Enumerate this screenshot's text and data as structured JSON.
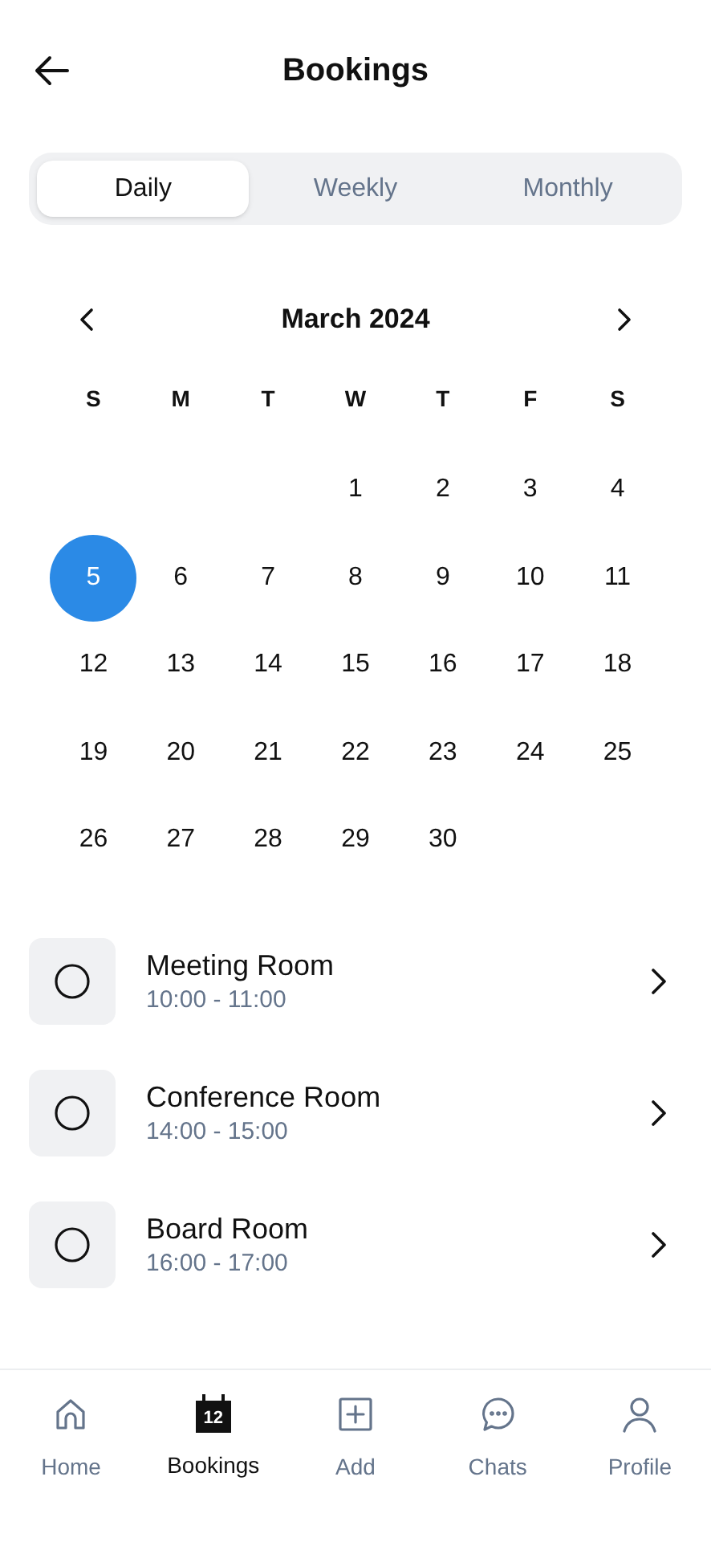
{
  "header": {
    "title": "Bookings"
  },
  "tabs": [
    {
      "label": "Daily",
      "selected": true
    },
    {
      "label": "Weekly",
      "selected": false
    },
    {
      "label": "Monthly",
      "selected": false
    }
  ],
  "calendar": {
    "month": "March 2024",
    "weekdays": [
      "S",
      "M",
      "T",
      "W",
      "T",
      "F",
      "S"
    ],
    "weeks": [
      [
        {
          "day": "1",
          "selected": false
        },
        {
          "day": "2",
          "selected": false
        },
        {
          "day": "3",
          "selected": false
        },
        {
          "day": "4",
          "selected": false
        }
      ],
      [
        {
          "day": "5",
          "selected": true
        },
        {
          "day": "6",
          "selected": false
        },
        {
          "day": "7",
          "selected": false
        },
        {
          "day": "8",
          "selected": false
        },
        {
          "day": "9",
          "selected": false
        },
        {
          "day": "10",
          "selected": false
        },
        {
          "day": "11",
          "selected": false
        }
      ],
      [
        {
          "day": "12",
          "selected": false
        },
        {
          "day": "13",
          "selected": false
        },
        {
          "day": "14",
          "selected": false
        },
        {
          "day": "15",
          "selected": false
        },
        {
          "day": "16",
          "selected": false
        },
        {
          "day": "17",
          "selected": false
        },
        {
          "day": "18",
          "selected": false
        }
      ],
      [
        {
          "day": "19",
          "selected": false
        },
        {
          "day": "20",
          "selected": false
        },
        {
          "day": "21",
          "selected": false
        },
        {
          "day": "22",
          "selected": false
        },
        {
          "day": "23",
          "selected": false
        },
        {
          "day": "24",
          "selected": false
        },
        {
          "day": "25",
          "selected": false
        }
      ],
      [
        {
          "day": "26",
          "selected": false
        },
        {
          "day": "27",
          "selected": false
        },
        {
          "day": "28",
          "selected": false
        },
        {
          "day": "29",
          "selected": false
        },
        {
          "day": "30",
          "selected": false
        }
      ]
    ]
  },
  "bookings": [
    {
      "name": "Meeting Room",
      "time": "10:00 - 11:00"
    },
    {
      "name": "Conference Room",
      "time": "14:00 - 15:00"
    },
    {
      "name": "Board Room",
      "time": "16:00 - 17:00"
    }
  ],
  "nav": [
    {
      "kind": "home",
      "label": "Home",
      "selected": false
    },
    {
      "kind": "calendar",
      "label": "Bookings",
      "selected": true,
      "icon_text": "12"
    },
    {
      "kind": "add",
      "label": "Add",
      "selected": false
    },
    {
      "kind": "chat",
      "label": "Chats",
      "selected": false
    },
    {
      "kind": "profile",
      "label": "Profile",
      "selected": false
    }
  ]
}
